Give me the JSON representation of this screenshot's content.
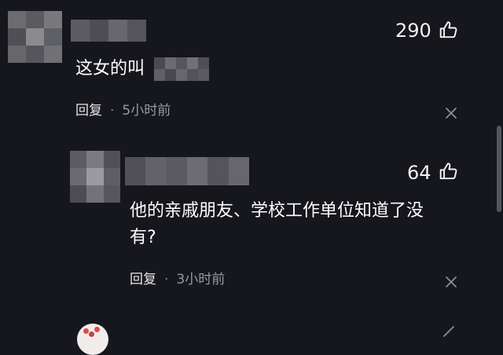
{
  "comments": [
    {
      "likes": "290",
      "text_visible": "这女的叫",
      "reply_label": "回复",
      "separator": "·",
      "time": "5小时前"
    },
    {
      "likes": "64",
      "text_line1": "他的亲戚朋友、学校工作单位知道了没",
      "text_line2": "有?",
      "reply_label": "回复",
      "separator": "·",
      "time": "3小时前"
    }
  ],
  "icons": {
    "like": "thumbs-up-icon",
    "close": "close-icon",
    "more": "more-icon"
  },
  "colors": {
    "background": "#16161d",
    "text": "#ffffff",
    "muted": "#9a9aa2"
  }
}
